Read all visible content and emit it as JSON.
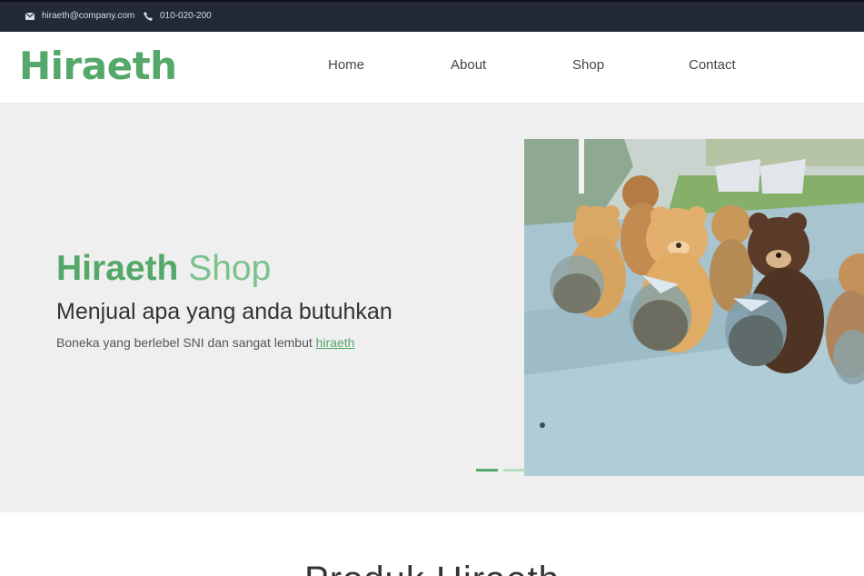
{
  "topbar": {
    "email": "hiraeth@company.com",
    "phone": "010-020-200"
  },
  "brand": {
    "logo": "Hiraeth",
    "accent_color": "#54a86a"
  },
  "nav": {
    "items": [
      {
        "label": "Home"
      },
      {
        "label": "About"
      },
      {
        "label": "Shop"
      },
      {
        "label": "Contact"
      }
    ]
  },
  "hero": {
    "title_part1": "Hiraeth",
    "title_part2": "Shop",
    "subtitle": "Menjual apa yang anda butuhkan",
    "description": "Boneka yang berlebel SNI dan sangat lembut",
    "link_text": "hiraeth",
    "slides_total": 2,
    "active_slide": 1
  },
  "section": {
    "title": "Produk Hiraeth"
  }
}
